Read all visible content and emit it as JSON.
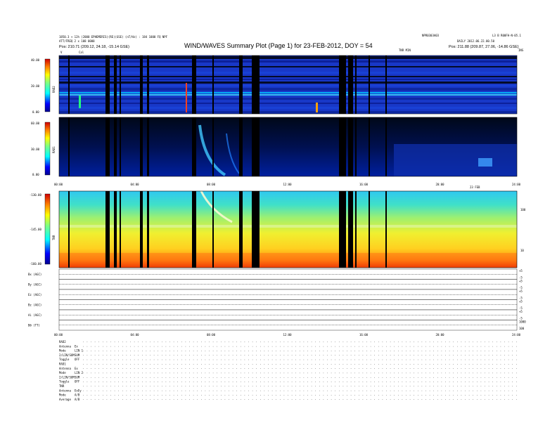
{
  "header": {
    "title": "WIND/WAVES Summary Plot (Page 1) for 23-FEB-2012, DOY = 54",
    "left_info": [
      "1850.3 + 12h (2000 EPHEMERIS)(RE)(GSE) (nT/Hz) : 184 1000 FQ NPF",
      "ATT/FREQ 2 x 108 0000"
    ],
    "left_pos": "Pos: 210.71 (209.12, 24.18, -15.14 GSE)",
    "center_right_info": "NPR0303A03",
    "right_info": [
      "L3 B R00FH-N-05.1",
      "DAILY 2012.06.22.00.50"
    ],
    "right_pos": "Pos: 211.88 (209.87, 27.06, -14.86 GSE)",
    "marker_left": "V",
    "marker_cal": "Cal",
    "marker_tnrmid": "TNR MIN",
    "marker_right": "INS"
  },
  "chart_data": [
    {
      "type": "heatmap",
      "name_label": "RAD2",
      "colorbar_ticks": [
        "40.00",
        "20.00",
        "0.00"
      ],
      "y_range": [
        0,
        40
      ],
      "description_rows": "spectrogram RAD2"
    },
    {
      "type": "heatmap",
      "name_label": "RAD1",
      "colorbar_ticks": [
        "60.00",
        "30.00",
        "0.00"
      ],
      "y_range": [
        0,
        60
      ]
    },
    {
      "type": "heatmap",
      "name_label": "TNR",
      "colorbar_ticks": [
        "-130.00",
        "-145.00",
        "-160.00"
      ],
      "y_range": [
        -160,
        -130
      ],
      "right_axis_ticks": [
        "100",
        "10"
      ],
      "right_axis_label": "kHz"
    }
  ],
  "time_axis": {
    "ticks": [
      "00:00",
      "04:00",
      "08:00",
      "12:00",
      "16:00",
      "20:00",
      "24:00"
    ],
    "date_label": "23 FEB"
  },
  "lower_time_axis": {
    "ticks": [
      "00:00",
      "04:00",
      "08:00",
      "12:00",
      "16:00",
      "20:00",
      "24:00"
    ]
  },
  "traces": [
    {
      "label": "Bx (AGC)",
      "ticks": [
        "+5",
        "-5"
      ]
    },
    {
      "label": "By (AGC)",
      "ticks": [
        "+5",
        "-5"
      ]
    },
    {
      "label": "Ez (AGC)",
      "ticks": [
        "+5",
        "-5"
      ]
    },
    {
      "label": "Bz (AGC)",
      "ticks": [
        "+5",
        "-5"
      ]
    },
    {
      "label": "Ai (AGC)",
      "ticks": [
        "+5",
        "-5"
      ]
    },
    {
      "label": "Bθ (TT)",
      "ticks": [
        "1000",
        "100"
      ]
    }
  ],
  "settings_block": [
    {
      "label": "RAD2",
      "value": ""
    },
    {
      "label": "Antenna",
      "value": "Ex"
    },
    {
      "label": "Mode",
      "value": "LIN 1"
    },
    {
      "label": "2/LIN/SUM",
      "value": "SUM"
    },
    {
      "label": "Toggle",
      "value": "OFF"
    },
    {
      "label": "RAD1",
      "value": ""
    },
    {
      "label": "Antenna",
      "value": "Ex"
    },
    {
      "label": "Mode",
      "value": "LIN 2"
    },
    {
      "label": "2/LIN/SUM",
      "value": "SUM"
    },
    {
      "label": "Toggle",
      "value": "OFF"
    },
    {
      "label": "TNR",
      "value": ""
    },
    {
      "label": "Antenna",
      "value": "ExEy"
    },
    {
      "label": "Mode",
      "value": "A/B"
    },
    {
      "label": "Average",
      "value": "A/B"
    }
  ],
  "colors": {
    "spectrogram_bg_high": "#1030c0",
    "dropout": "#000000"
  }
}
